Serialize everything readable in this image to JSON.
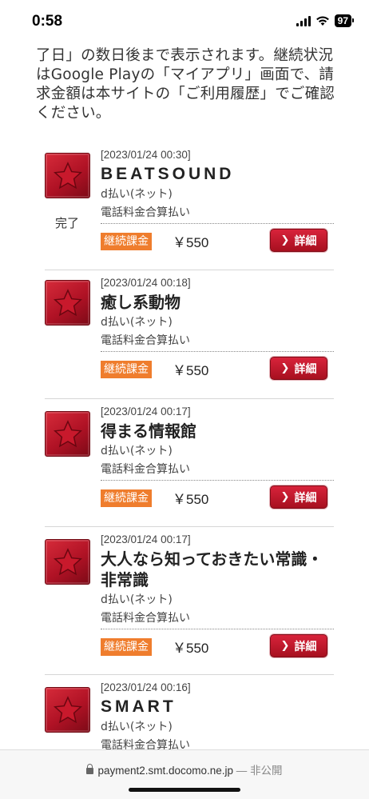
{
  "status_bar": {
    "time": "0:58",
    "battery": "97"
  },
  "intro_text": "了日」の数日後まで表示されます。継続状況はGoogle Playの「マイアプリ」画面で、請求金額は本サイトの「ご利用履歴」でご確認ください。",
  "items": [
    {
      "date": "[2023/01/24 00:30]",
      "title": "BEATSOUND",
      "method": "d払い(ネット)",
      "billing": "電話料金合算払い",
      "badge": "継続課金",
      "price": "￥550",
      "detail": "詳細",
      "status": "完了"
    },
    {
      "date": "[2023/01/24 00:18]",
      "title": "癒し系動物",
      "method": "d払い(ネット)",
      "billing": "電話料金合算払い",
      "badge": "継続課金",
      "price": "￥550",
      "detail": "詳細"
    },
    {
      "date": "[2023/01/24 00:17]",
      "title": "得まる情報館",
      "method": "d払い(ネット)",
      "billing": "電話料金合算払い",
      "badge": "継続課金",
      "price": "￥550",
      "detail": "詳細"
    },
    {
      "date": "[2023/01/24 00:17]",
      "title": "大人なら知っておきたい常識・非常識",
      "method": "d払い(ネット)",
      "billing": "電話料金合算払い",
      "badge": "継続課金",
      "price": "￥550",
      "detail": "詳細"
    },
    {
      "date": "[2023/01/24 00:16]",
      "title": "SMART",
      "method": "d払い(ネット)",
      "billing": "電話料金合算払い"
    }
  ],
  "bottom_bar": {
    "url": "payment2.smt.docomo.ne.jp",
    "separator": "—",
    "visibility": "非公開"
  },
  "colors": {
    "accent_red": "#c0182c",
    "badge_orange": "#ef7d2d"
  }
}
